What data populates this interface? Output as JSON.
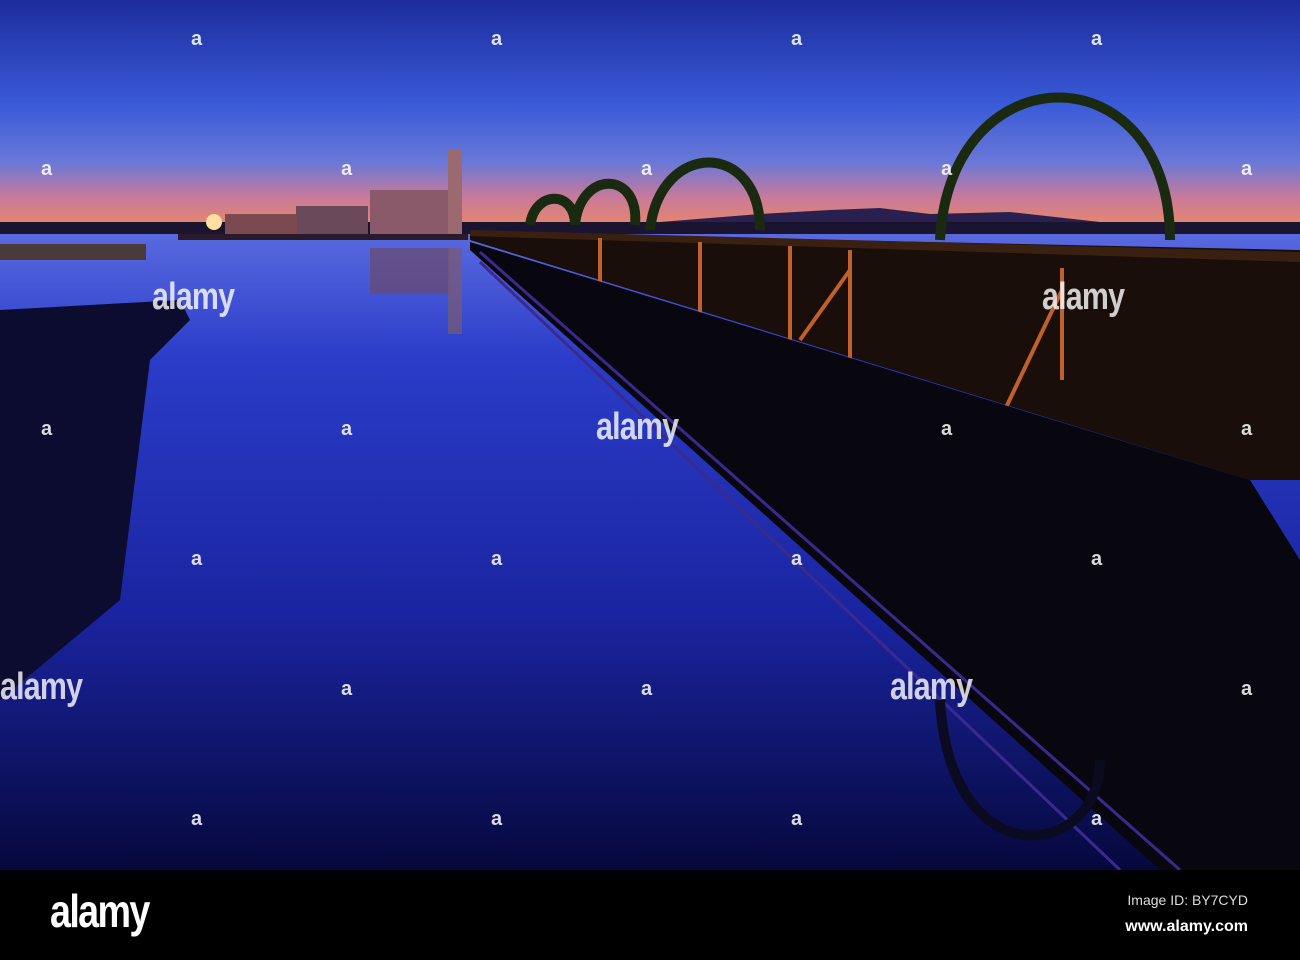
{
  "watermark": {
    "text": "alamy",
    "mark": "a"
  },
  "footer": {
    "logo": "alamy",
    "image_id": "Image ID: BY7CYD",
    "site": "www.alamy.com"
  },
  "colors": {
    "sky_top": "#1c2c9c",
    "horizon": "#e8866a",
    "water_top": "#2a3cc4",
    "water_bottom": "#06083c",
    "bridge": "#1a0e0a",
    "wood": "#c0602a"
  }
}
